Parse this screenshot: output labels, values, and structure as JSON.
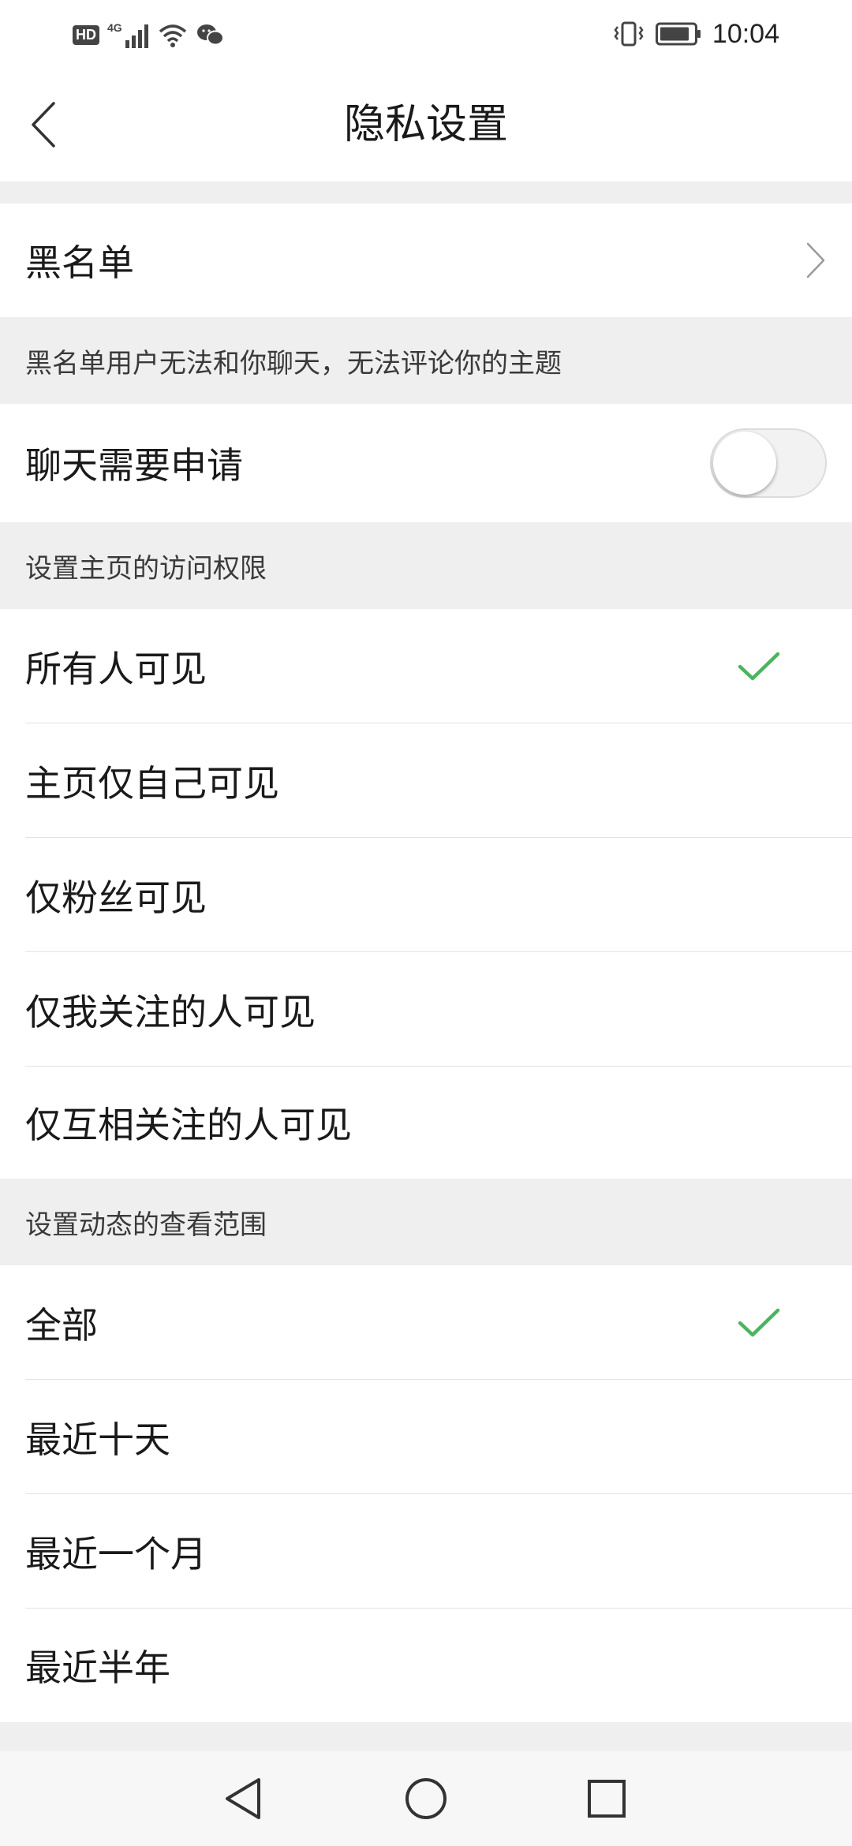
{
  "status_bar": {
    "hd": "HD",
    "network": "4G",
    "time": "10:04"
  },
  "header": {
    "title": "隐私设置"
  },
  "blacklist": {
    "label": "黑名单",
    "note": "黑名单用户无法和你聊天，无法评论你的主题"
  },
  "chat_request": {
    "label": "聊天需要申请",
    "enabled": false
  },
  "homepage_access": {
    "header": "设置主页的访问权限",
    "options": [
      {
        "label": "所有人可见",
        "selected": true
      },
      {
        "label": "主页仅自己可见",
        "selected": false
      },
      {
        "label": "仅粉丝可见",
        "selected": false
      },
      {
        "label": "仅我关注的人可见",
        "selected": false
      },
      {
        "label": "仅互相关注的人可见",
        "selected": false
      }
    ]
  },
  "feed_range": {
    "header": "设置动态的查看范围",
    "options": [
      {
        "label": "全部",
        "selected": true
      },
      {
        "label": "最近十天",
        "selected": false
      },
      {
        "label": "最近一个月",
        "selected": false
      },
      {
        "label": "最近半年",
        "selected": false
      }
    ]
  },
  "colors": {
    "accent_check": "#4cb45e",
    "background": "#efefef",
    "row": "#ffffff"
  },
  "icons": {
    "back": "chevron-left-icon",
    "blacklist_arrow": "chevron-right-icon",
    "selected": "checkmark-icon",
    "nav_back": "triangle-back-icon",
    "nav_home": "circle-home-icon",
    "nav_recents": "square-recents-icon"
  }
}
